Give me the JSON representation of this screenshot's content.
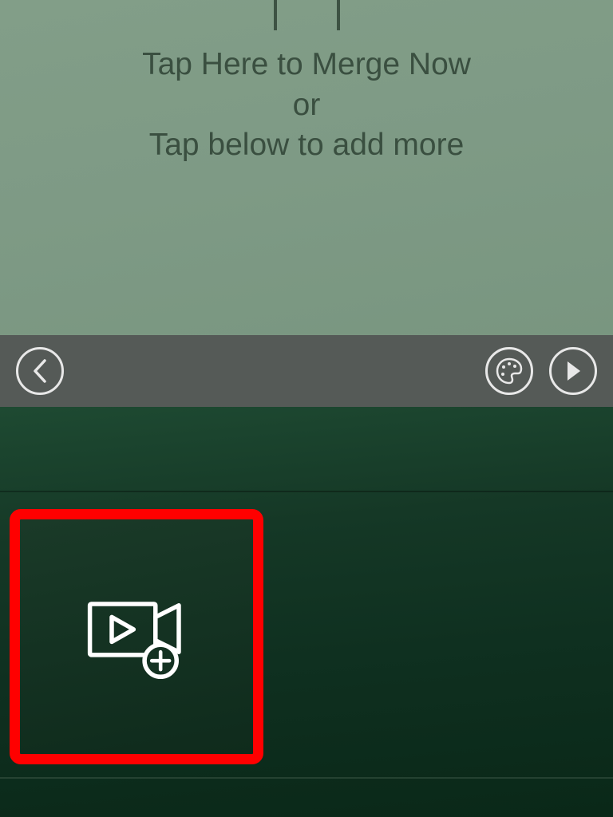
{
  "instructions": {
    "line1": "Tap Here to Merge Now",
    "line2": "or",
    "line3": "Tap below to add more"
  },
  "toolbar": {
    "back_label": "Back",
    "palette_label": "Color Palette",
    "play_label": "Play"
  },
  "media": {
    "add_label": "Add Video"
  },
  "highlight": {
    "color": "#ff0000"
  }
}
